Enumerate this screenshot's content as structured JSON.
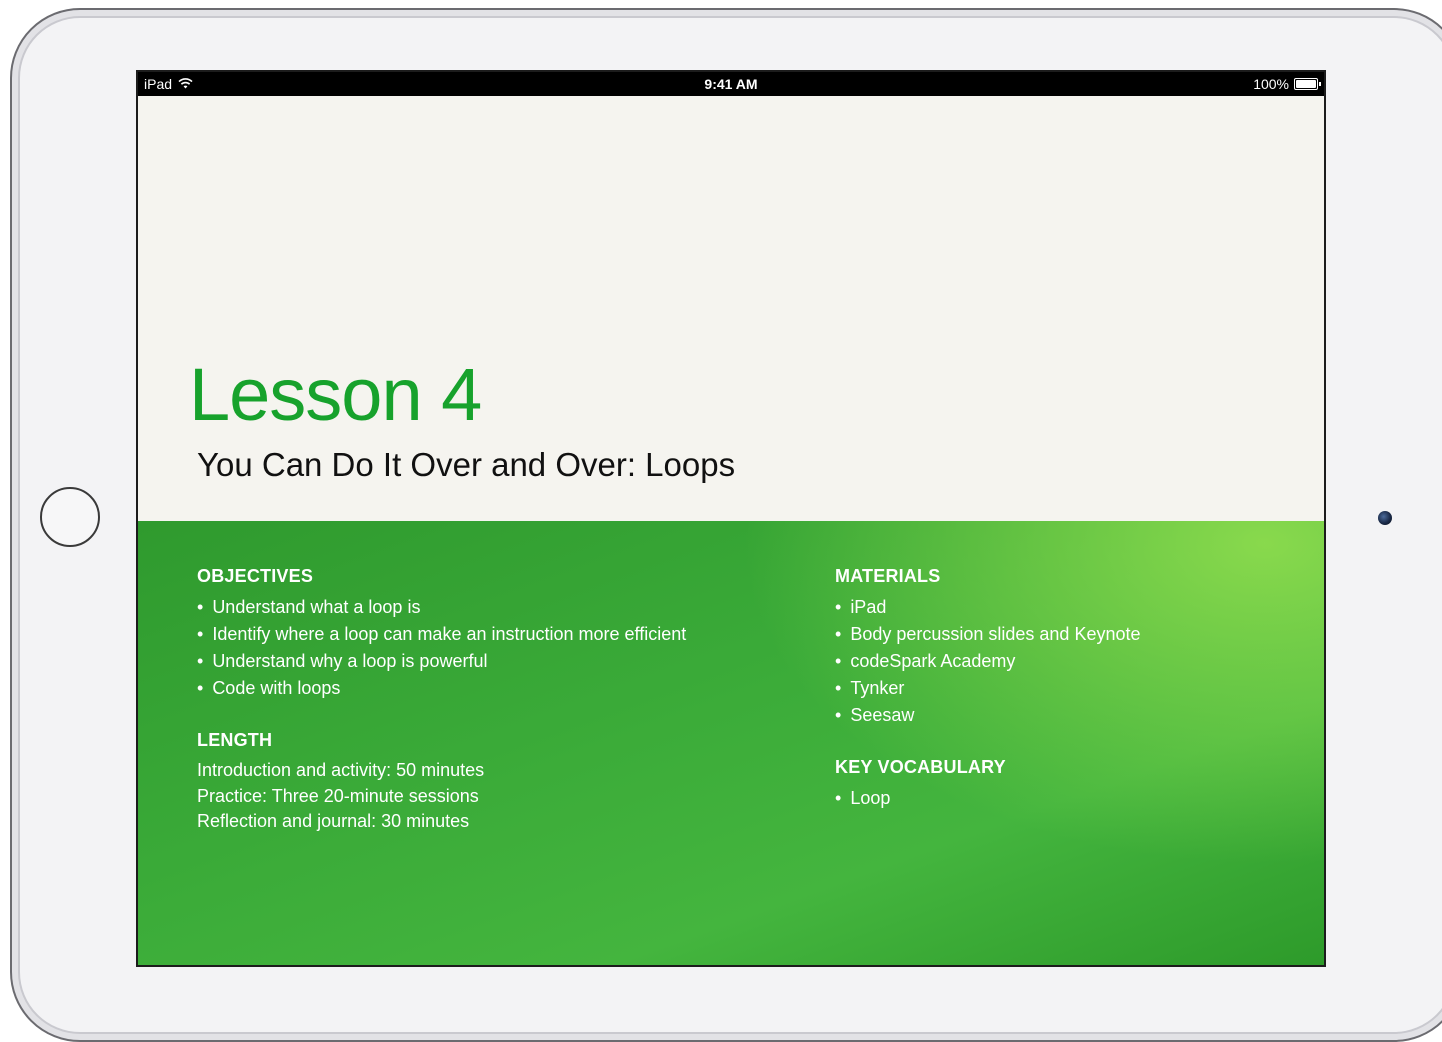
{
  "status_bar": {
    "device": "iPad",
    "wifi_icon": "wifi-icon",
    "time": "9:41 AM",
    "battery_percent": "100%",
    "battery_level": 1.0
  },
  "lesson": {
    "title": "Lesson 4",
    "subtitle": "You Can Do It Over and Over: Loops"
  },
  "objectives": {
    "heading": "OBJECTIVES",
    "items": [
      "Understand what a loop is",
      "Identify where a loop can make an instruction more efficient",
      "Understand why a loop is powerful",
      "Code with loops"
    ]
  },
  "length": {
    "heading": "LENGTH",
    "lines": [
      "Introduction and activity: 50 minutes",
      "Practice: Three 20-minute sessions",
      "Reflection and journal: 30 minutes"
    ]
  },
  "materials": {
    "heading": "MATERIALS",
    "items": [
      "iPad",
      "Body percussion slides and Keynote",
      "codeSpark Academy",
      "Tynker",
      "Seesaw"
    ]
  },
  "key_vocabulary": {
    "heading": "KEY VOCABULARY",
    "items": [
      "Loop"
    ]
  },
  "colors": {
    "title_green": "#17a22c",
    "panel_green": "#3aaa38",
    "header_background": "#f5f4ef"
  }
}
